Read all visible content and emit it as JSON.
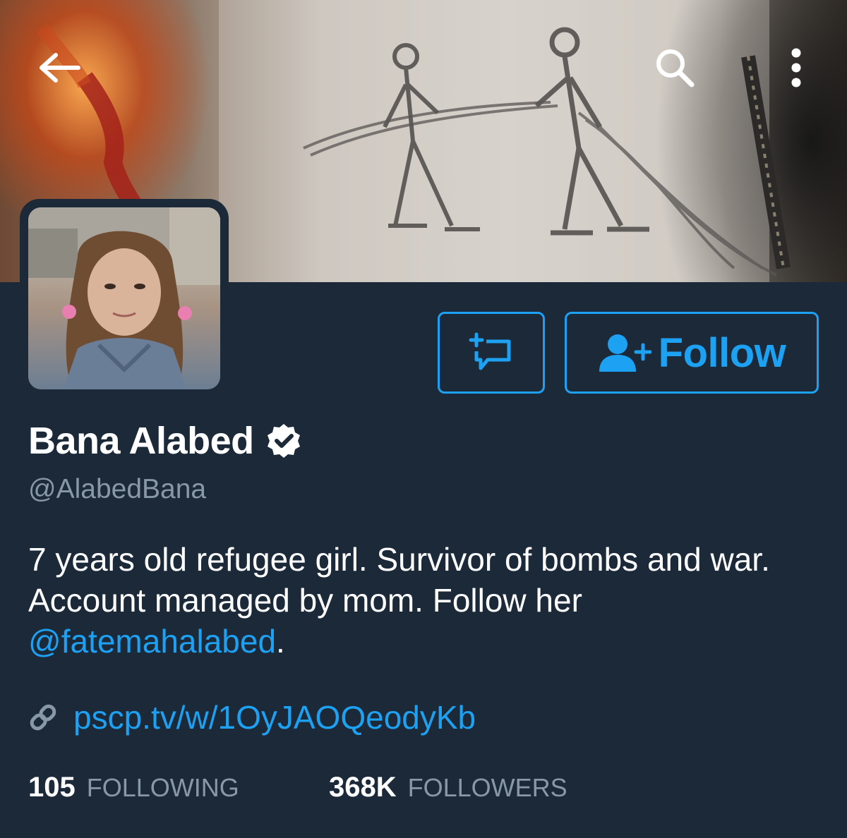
{
  "profile": {
    "display_name": "Bana Alabed",
    "handle": "@AlabedBana",
    "verified": true,
    "bio_text": "7 years old refugee girl. Survivor of bombs and war. Account managed by mom. Follow her ",
    "bio_mention": "@fatemahalabed",
    "bio_end": ".",
    "link": "pscp.tv/w/1OyJAOQeodyKb"
  },
  "actions": {
    "follow_label": "Follow"
  },
  "stats": {
    "following_count": "105",
    "following_label": "FOLLOWING",
    "followers_count": "368K",
    "followers_label": "FOLLOWERS"
  },
  "icons": {
    "back": "arrow-left-icon",
    "search": "search-icon",
    "more": "more-vertical-icon",
    "tweet_to": "tweet-to-icon",
    "follow": "add-user-icon",
    "verified": "verified-badge-icon",
    "link": "link-icon"
  },
  "colors": {
    "background": "#1c2938",
    "accent": "#1da1f2",
    "secondary_text": "#8899a6",
    "primary_text": "#ffffff"
  }
}
